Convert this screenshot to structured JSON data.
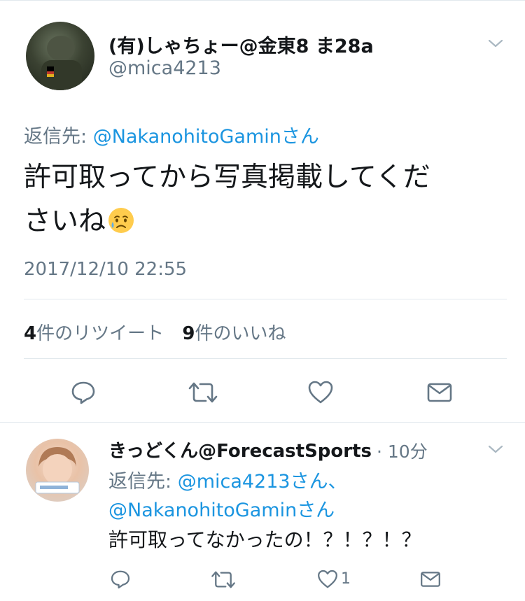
{
  "tweet": {
    "author_name": "(有)しゃちょー@金東8 ま28a",
    "author_handle": "@mica4213",
    "reply_prefix": "返信先: ",
    "reply_mention": "@NakanohitoGamin",
    "reply_suffix": "さん",
    "text_line1": "許可取ってから写真掲載してくだ",
    "text_line2": "さいね",
    "emoji": "sad-but-relieved-face",
    "timestamp": "2017/12/10 22:55",
    "retweet_count": "4",
    "retweet_label": "件のリツイート",
    "like_count": "9",
    "like_label": "件のいいね"
  },
  "reply": {
    "author_name": "きっどくん@ForecastSports",
    "time_sep": "·",
    "time": "10分",
    "reply_prefix": "返信先: ",
    "mention1": "@mica4213",
    "mention1_suffix": "さん、",
    "mention2": "@NakanohitoGamin",
    "mention2_suffix": "さん",
    "text": "許可取ってなかったの！？！？！？",
    "like_count": "1"
  },
  "colors": {
    "link": "#1b95e0",
    "secondary": "#657786",
    "divider": "#e1e8ed",
    "icon": "#657786"
  }
}
